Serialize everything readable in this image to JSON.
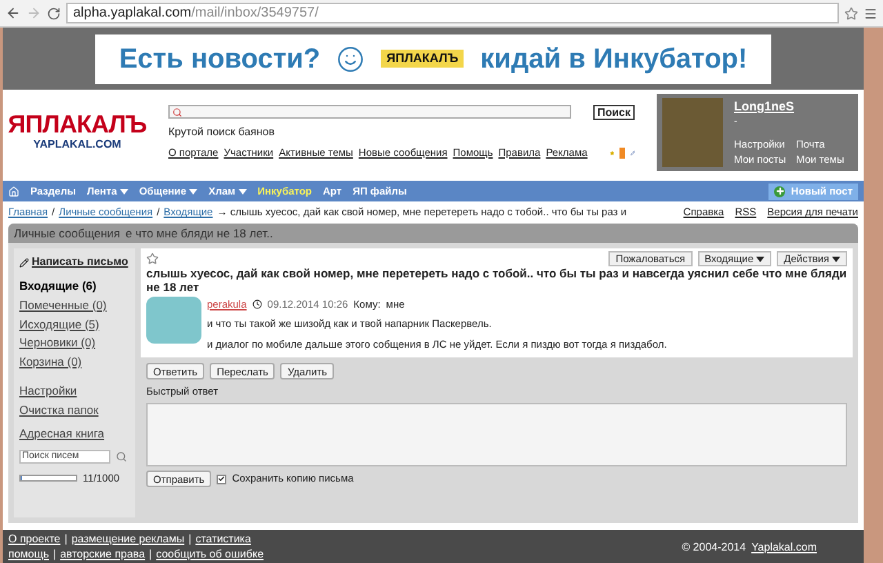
{
  "browser": {
    "url_host": "alpha.yaplakal.com",
    "url_path": "/mail/inbox/3549757/"
  },
  "banner": {
    "left": "Есть новости?",
    "logo": "ЯПЛАКАЛЪ",
    "right": "кидай в Инкубатор!"
  },
  "header": {
    "logo_title": "ЯПЛАКАЛЪ",
    "logo_subtitle": "YAPLAKAL.COM",
    "search_button": "Поиск",
    "search_hint": "Крутой поиск баянов",
    "links": [
      "О портале",
      "Участники",
      "Активные темы",
      "Новые сообщения",
      "Помощь",
      "Правила",
      "Реклама"
    ],
    "user": {
      "name": "Long1neS",
      "status": "-",
      "links": [
        "Настройки",
        "Почта",
        "Мои посты",
        "Мои темы"
      ]
    }
  },
  "nav": {
    "items": [
      {
        "label": "Разделы",
        "dropdown": false,
        "highlighted": false
      },
      {
        "label": "Лента",
        "dropdown": true,
        "highlighted": false
      },
      {
        "label": "Общение",
        "dropdown": true,
        "highlighted": false
      },
      {
        "label": "Хлам",
        "dropdown": true,
        "highlighted": false
      },
      {
        "label": "Инкубатор",
        "dropdown": false,
        "highlighted": true
      },
      {
        "label": "Арт",
        "dropdown": false,
        "highlighted": false
      },
      {
        "label": "ЯП файлы",
        "dropdown": false,
        "highlighted": false
      }
    ],
    "new_post": "Новый пост"
  },
  "breadcrumb": {
    "separator": "/",
    "links": [
      "Главная",
      "Личные сообщения",
      "Входящие"
    ],
    "current": "→ слышь хуесос, дай как свой номер, мне перетереть надо с тобой.. что бы ты раз и",
    "tools": [
      "Справка",
      "RSS",
      "Версия для печати"
    ]
  },
  "panel": {
    "title": "Личные сообщения",
    "overflow": "е что мне бляди не 18 лет.."
  },
  "sidebar": {
    "compose": "Написать письмо",
    "folders": [
      {
        "label": "Входящие (6)",
        "selected": true
      },
      {
        "label": "Помеченные (0)",
        "selected": false
      },
      {
        "label": "Исходящие (5)",
        "selected": false
      },
      {
        "label": "Черновики (0)",
        "selected": false
      },
      {
        "label": "Корзина (0)",
        "selected": false
      }
    ],
    "tools": [
      "Настройки",
      "Очистка папок"
    ],
    "address_book": "Адресная книга",
    "search_placeholder": "Поиск писем",
    "quota": {
      "level": 0.011,
      "reading": "11/1000"
    }
  },
  "message": {
    "starred": false,
    "actions": [
      {
        "label": "Пожаловаться",
        "dropdown": false
      },
      {
        "label": "Входящие",
        "dropdown": true
      },
      {
        "label": "Действия",
        "dropdown": true
      }
    ],
    "subject": "слышь хуесос, дай как свой номер, мне перетереть надо с тобой.. что бы ты раз и навсегда уяснил себе что мне бляди не 18 лет",
    "author": "perakula",
    "date": "09.12.2014 10:26",
    "to_label": "Кому:",
    "to": "мне",
    "body": [
      "и что ты такой же шизойд как и твой напарник Паскервель.",
      "и диалог по мобиле дальше этого собщения в ЛС не уйдет. Если я пиздю вот тогда я пиздабол."
    ]
  },
  "buttons": [
    "Ответить",
    "Переслать",
    "Удалить"
  ],
  "quick_reply": {
    "label": "Быстрый ответ",
    "send": "Отправить",
    "save_copy": {
      "label": "Сохранить копию письма",
      "checked": true
    }
  },
  "footer": {
    "separator": "|",
    "rows": [
      [
        "О проекте",
        "размещение рекламы",
        "статистика"
      ],
      [
        "помощь",
        "авторские права",
        "сообщить об ошибке"
      ]
    ],
    "copyright": "© 2004-2014",
    "site": "Yaplakal.com"
  }
}
